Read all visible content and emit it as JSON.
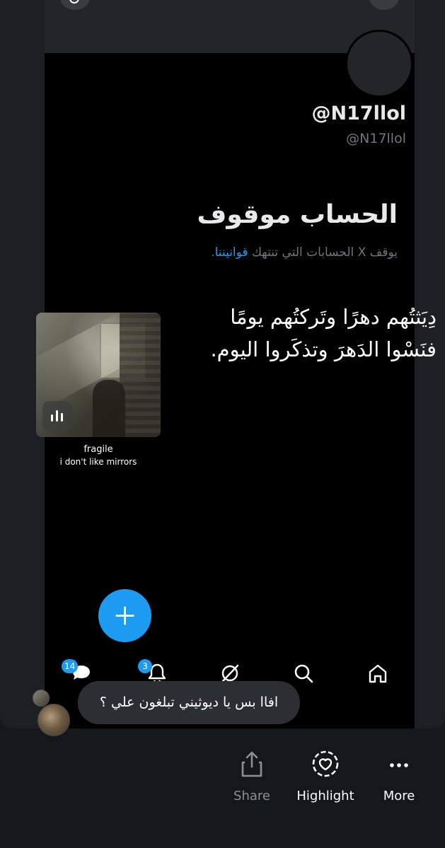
{
  "profile": {
    "handle_display": "@N17llol",
    "handle": "@N17llol"
  },
  "suspended": {
    "title": "الحساب موقوف",
    "description_prefix": "يوقف X الحسابات التي تنتهك",
    "description_link": "قوانيننا",
    "description_suffix": "."
  },
  "quote": {
    "line1": "دِيَثتُهم دهرًا وتَركتُهم يومًا",
    "line2": "فنَسْوا الدَهرَ وتذكَروا اليوم."
  },
  "music": {
    "title": "fragile",
    "artist": "i don't like mirrors"
  },
  "nav": {
    "messages_badge": "14",
    "notifications_badge": "3"
  },
  "comment": {
    "text": "افاا بس يا ديوثيني تبلغون علي ؟"
  },
  "actions": {
    "share": "Share",
    "highlight": "Highlight",
    "more": "More"
  },
  "colors": {
    "accent": "#1d9bf0",
    "background": "#000000",
    "muted": "#71767b"
  }
}
